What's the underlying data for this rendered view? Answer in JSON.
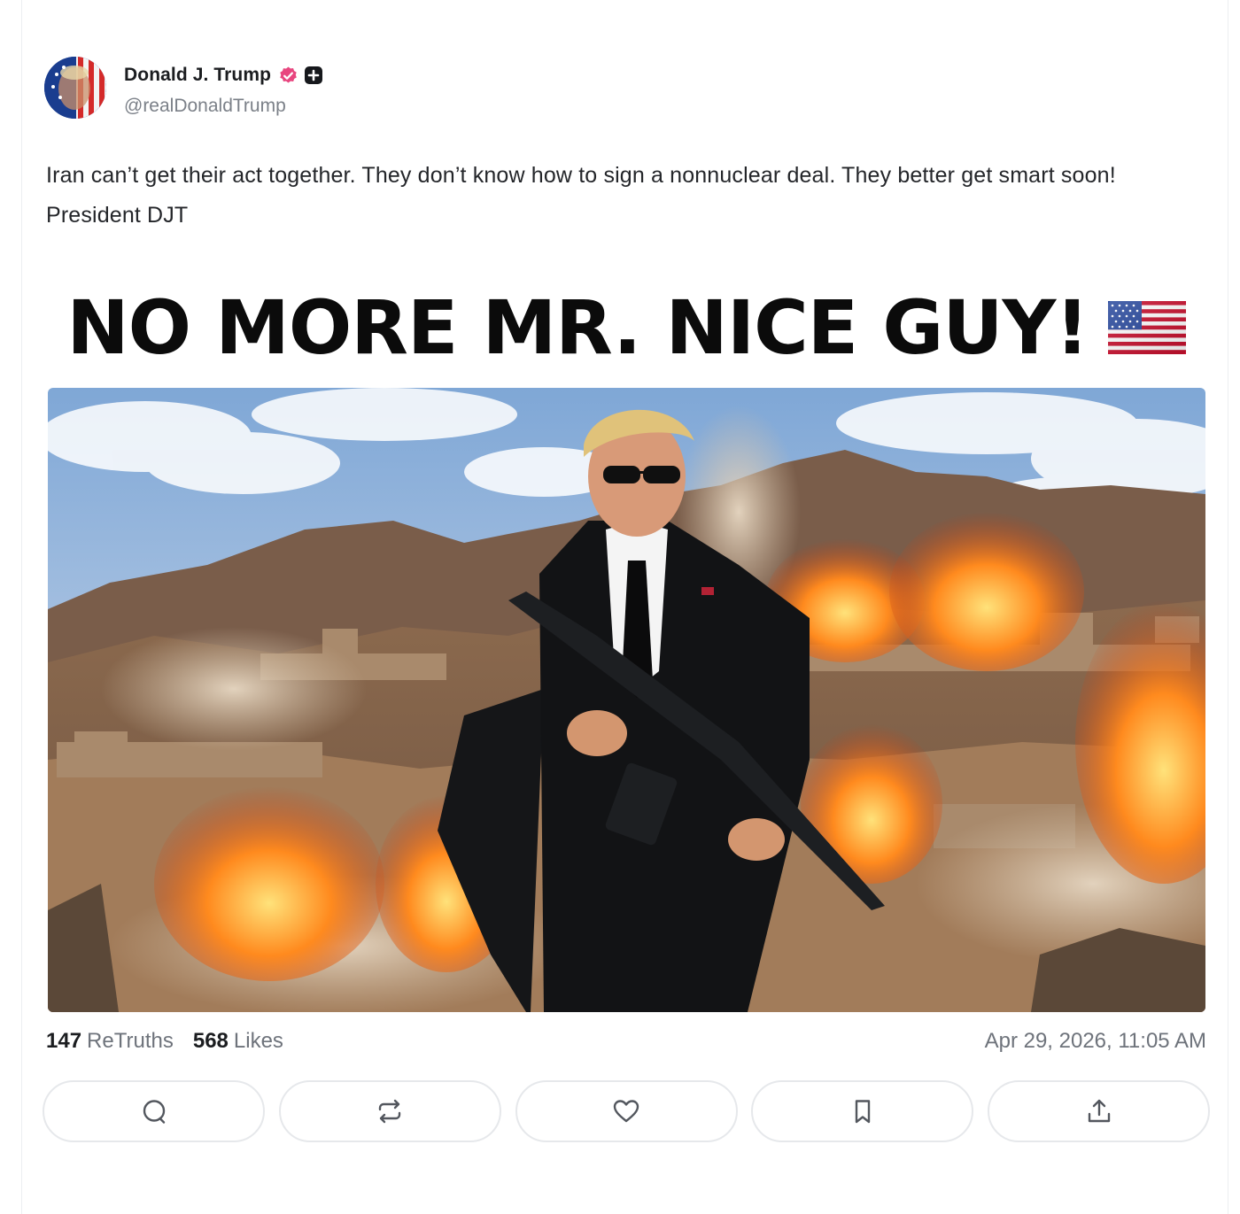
{
  "author": {
    "name": "Donald J. Trump",
    "handle": "@realDonaldTrump",
    "avatar_icon": "flag-portrait-avatar",
    "verified_icon": "verified-badge-icon",
    "badge_icon": "plus-square-icon",
    "verified_color": "#e8467f"
  },
  "post": {
    "text": "Iran can’t get their act together. They don’t know how to sign a nonnuclear deal. They better get smart soon! President DJT"
  },
  "media": {
    "headline": "NO MORE MR. NICE GUY!",
    "headline_emoji_icon": "us-flag-icon"
  },
  "stats": {
    "retruths_count": "147",
    "retruths_label": "ReTruths",
    "likes_count": "568",
    "likes_label": "Likes",
    "timestamp": "Apr 29, 2026, 11:05 AM"
  },
  "actions": [
    {
      "name": "reply-button",
      "icon": "comment-icon"
    },
    {
      "name": "retruth-button",
      "icon": "repost-icon"
    },
    {
      "name": "like-button",
      "icon": "heart-icon"
    },
    {
      "name": "bookmark-button",
      "icon": "bookmark-icon"
    },
    {
      "name": "share-button",
      "icon": "share-upload-icon"
    }
  ]
}
